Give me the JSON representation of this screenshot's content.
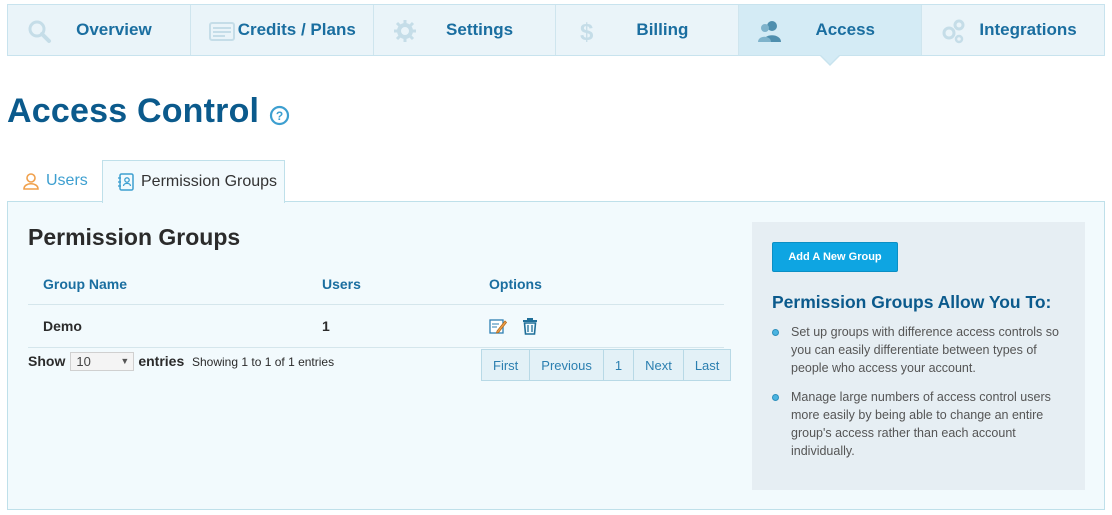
{
  "nav": {
    "items": [
      {
        "label": "Overview",
        "icon": "search-icon"
      },
      {
        "label": "Credits / Plans",
        "icon": "credit-card-icon"
      },
      {
        "label": "Settings",
        "icon": "gear-icon"
      },
      {
        "label": "Billing",
        "icon": "dollar-icon"
      },
      {
        "label": "Access",
        "icon": "users-icon",
        "active": true
      },
      {
        "label": "Integrations",
        "icon": "gears-icon"
      }
    ]
  },
  "page": {
    "title": "Access Control"
  },
  "tabs": [
    {
      "label": "Users",
      "icon": "user-icon"
    },
    {
      "label": "Permission Groups",
      "icon": "address-book-icon",
      "active": true
    }
  ],
  "panel": {
    "title": "Permission Groups",
    "columns": [
      "Group Name",
      "Users",
      "Options"
    ],
    "rows": [
      {
        "name": "Demo",
        "users": "1"
      }
    ],
    "show_label": "Show",
    "page_size": "10",
    "entries_label": "entries",
    "info": "Showing 1 to 1 of 1 entries",
    "pager": [
      "First",
      "Previous",
      "1",
      "Next",
      "Last"
    ]
  },
  "sidebox": {
    "add_button": "Add A New Group",
    "heading": "Permission Groups Allow You To:",
    "bullets": [
      "Set up groups with difference access controls so you can easily differentiate between types of people who access your account.",
      "Manage large numbers of access control users more easily by being able to change an entire group's access rather than each account individually."
    ]
  },
  "colors": {
    "accent": "#0ea5e2",
    "title": "#0b5a8c",
    "nav_text": "#1a6ea0"
  }
}
